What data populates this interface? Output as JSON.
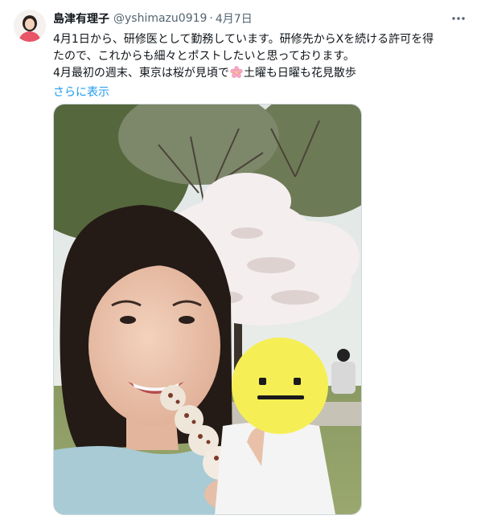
{
  "tweet": {
    "author_name": "島津有理子",
    "author_handle": "@yshimazu0919",
    "separator": "·",
    "date": "4月7日",
    "text_line1": "4月1日から、研修医として勤務しています。研修先からXを続ける許可を得",
    "text_line2": "たので、これからも細々とポストしたいと思っております。",
    "text_line3_before_emoji": "4月最初の週末、東京は桜が見頃で",
    "text_line3_after_emoji": "土曜も日曜も花見散歩",
    "emoji_icon": "cherry-blossom-icon",
    "show_more": "さらに表示",
    "more_icon": "more-horizontal-icon"
  },
  "colors": {
    "link": "#1d9bf0",
    "secondary_text": "#536471",
    "border": "#cfd9de",
    "smiley": "#f5ef55"
  }
}
